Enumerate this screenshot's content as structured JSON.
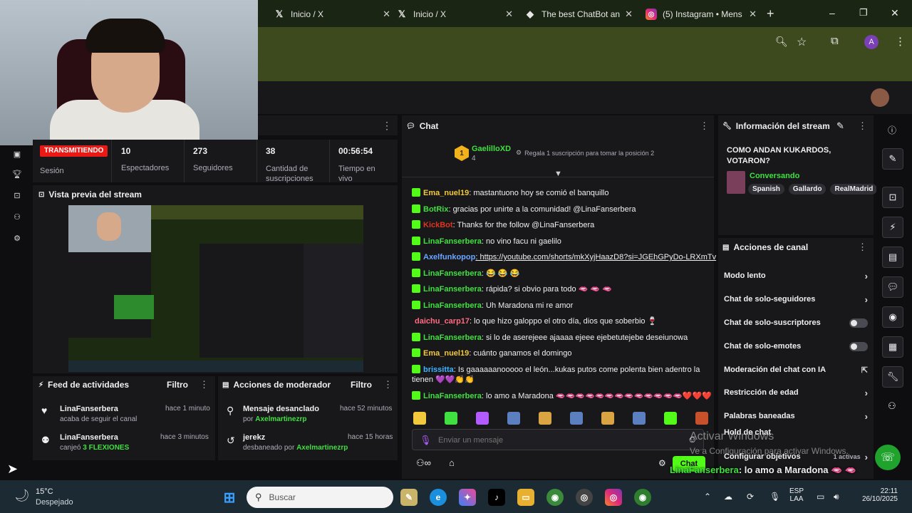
{
  "browser": {
    "tabs": [
      {
        "title": "Inicio / X",
        "icon": "x-logo-icon"
      },
      {
        "title": "Inicio / X",
        "icon": "x-logo-icon"
      },
      {
        "title": "The best ChatBot an",
        "icon": "kick-bot-icon"
      },
      {
        "title": "(5) Instagram • Mens",
        "icon": "instagram-icon"
      }
    ],
    "new_tab": "+",
    "profile_initial": "A",
    "window_controls": {
      "minimize": "–",
      "maximize": "❐",
      "close": "✕"
    }
  },
  "stats": {
    "live_badge": "TRANSMITIENDO",
    "session_label": "Sesión",
    "viewers_value": "10",
    "viewers_label": "Espectadores",
    "followers_value": "273",
    "followers_label": "Seguidores",
    "subs_value": "38",
    "subs_label": "Cantidad de suscripciones",
    "uptime_value": "00:56:54",
    "uptime_label": "Tiempo en vivo"
  },
  "preview": {
    "title": "Vista previa del stream"
  },
  "activity_feed": {
    "title": "Feed de actividades",
    "filter": "Filtro",
    "items": [
      {
        "user": "LinaFanserbera",
        "detail": "acaba de seguir el canal",
        "time": "hace 1 minuto"
      },
      {
        "user": "LinaFanserbera",
        "detail_prefix": "canjeó",
        "detail_highlight": "3 FLEXIONES",
        "time": "hace 3 minutos"
      }
    ]
  },
  "mod_actions": {
    "title": "Acciones de moderador",
    "filter": "Filtro",
    "items": [
      {
        "action": "Mensaje desanclado",
        "by_prefix": "por",
        "by_user": "Axelmartinezrp",
        "time": "hace 52 minutos"
      },
      {
        "action": "jerekz",
        "by_prefix": "desbaneado por",
        "by_user": "Axelmartinezrp",
        "time": "hace 15 horas"
      }
    ]
  },
  "chat": {
    "title": "Chat",
    "top_gifter": {
      "name": "GaelilloXD",
      "count": "4",
      "rank": "1",
      "gift_text": "Regala 1 suscripción para tomar la posición 2"
    },
    "messages": [
      {
        "user": "Ema_nuel19",
        "color": "#f2c83c",
        "text": ": mastantuono hoy se comió el banquillo"
      },
      {
        "user": "BotRix",
        "color": "#3fe03f",
        "text": ": gracias por unirte a la comunidad! @LinaFanserbera"
      },
      {
        "user": "KickBot",
        "color": "#e0331c",
        "text": ": Thanks for the follow @LinaFanserbera"
      },
      {
        "user": "LinaFanserbera",
        "color": "#3fe03f",
        "text": ": no vino facu ni gaelilo"
      },
      {
        "user": "Axelfunkopop",
        "color": "#6aa6ff",
        "text": ": https://youtube.com/shorts/mkXyjHaazD8?si=JGEhGPyDo-LRXmTv"
      },
      {
        "user": "LinaFanserbera",
        "color": "#3fe03f",
        "text": ": 😂 😂 😂"
      },
      {
        "user": "LinaFanserbera",
        "color": "#3fe03f",
        "text": ": rápida? si obvio para todo 🫦 🫦 🫦"
      },
      {
        "user": "LinaFanserbera",
        "color": "#3fe03f",
        "text": ": Uh Maradona mi re amor"
      },
      {
        "user": "daichu_carp17",
        "color": "#ff6b81",
        "text": ": lo que hizo galoppo el otro día, dios que soberbio 🍷"
      },
      {
        "user": "LinaFanserbera",
        "color": "#3fe03f",
        "text": ": si lo de aserejeee ajaaaa ejeee ejebetutejebe deseiunowa"
      },
      {
        "user": "Ema_nuel19",
        "color": "#f2c83c",
        "text": ": cuánto ganamos el domingo"
      },
      {
        "user": "brissitta",
        "color": "#3fb4ff",
        "text": ": Is gaaaaaanooooo el león...kukas putos come polenta bien adentro la tienen 💜💜👏👏"
      },
      {
        "user": "LinaFanserbera",
        "color": "#3fe03f",
        "text": ": lo amo a Maradona 🫦🫦🫦🫦🫦🫦🫦🫦🫦🫦🫦🫦🫦❤️❤️❤️"
      }
    ],
    "input_placeholder": "Enviar un mensaje",
    "send_label": "Chat",
    "overlay_user": "LinaFanserbera",
    "overlay_text": ": lo amo a Maradona 🫦 🫦",
    "overlay_line2": "🫦 🫦 🫦 🫦 🫦 🫦 🫦 🫦 🫦 🫦 🫦 ❤️ ❤️ ❤️"
  },
  "stream_info": {
    "title": "Información del stream",
    "stream_title": "COMO ANDAN KUKARDOS, VOTARON?",
    "category": "Conversando",
    "tags": [
      "Spanish",
      "Gallardo",
      "RealMadrid"
    ]
  },
  "channel_actions": {
    "title": "Acciones de canal",
    "items": [
      {
        "label": "Modo lento",
        "kind": "chevron"
      },
      {
        "label": "Chat de solo-seguidores",
        "kind": "chevron"
      },
      {
        "label": "Chat de solo-suscriptores",
        "kind": "toggle"
      },
      {
        "label": "Chat de solo-emotes",
        "kind": "toggle"
      },
      {
        "label": "Moderación del chat con IA",
        "kind": "external"
      },
      {
        "label": "Restricción de edad",
        "kind": "chevron"
      },
      {
        "label": "Palabras baneadas",
        "kind": "chevron"
      },
      {
        "label": "Hold de chat",
        "kind": "none"
      },
      {
        "label": "Configurar objetivos",
        "kind": "chevron"
      }
    ],
    "goals_badge": "1 activas"
  },
  "windows_watermark": {
    "line1": "Activar Windows",
    "line2": "Ve a Configuración para activar Windows."
  },
  "taskbar": {
    "weather_temp": "15°C",
    "weather_desc": "Despejado",
    "search_placeholder": "Buscar",
    "language": "ESP",
    "layout": "LAA",
    "time": "22:11",
    "date": "26/10/2025"
  },
  "colors": {
    "kick_green": "#53fc18",
    "live_red": "#e91916",
    "panel": "#18181b",
    "browser_chrome": "#3c4a1e"
  }
}
